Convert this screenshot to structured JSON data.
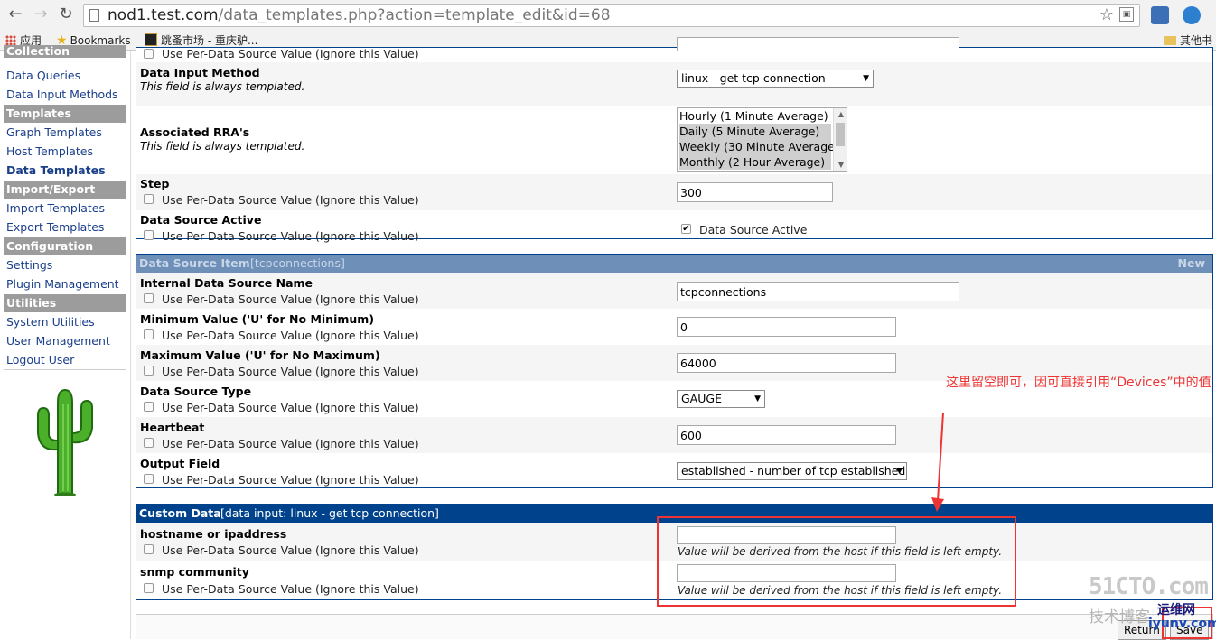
{
  "browser": {
    "url_host": "nod1.test.com",
    "url_path": "/data_templates.php?action=template_edit&id=68",
    "bookmarks": [
      {
        "label": "应用"
      },
      {
        "label": "Bookmarks"
      },
      {
        "label": "跳蚤市场 - 重庆驴..."
      },
      {
        "label": "其他书"
      }
    ]
  },
  "sidebar": {
    "cut_heading": "Collection Methods",
    "items": [
      {
        "label": "Data Queries"
      },
      {
        "label": "Data Input Methods"
      }
    ],
    "sections": [
      {
        "heading": "Templates",
        "items": [
          "Graph Templates",
          "Host Templates",
          "Data Templates"
        ]
      },
      {
        "heading": "Import/Export",
        "items": [
          "Import Templates",
          "Export Templates"
        ]
      },
      {
        "heading": "Configuration",
        "items": [
          "Settings",
          "Plugin Management"
        ]
      },
      {
        "heading": "Utilities",
        "items": [
          "System Utilities",
          "User Management",
          "Logout User"
        ]
      }
    ],
    "active_item": "Data Templates"
  },
  "common": {
    "per_ds_label": "Use Per-Data Source Value (Ignore this Value)",
    "always_templated": "This field is always templated.",
    "derived_hint": "Value will be derived from the host if this field is left empty."
  },
  "data_source": {
    "data_input_method_label": "Data Input Method",
    "data_input_method_value": "linux - get tcp connection",
    "rra_label": "Associated RRA's",
    "rra_options": [
      "Hourly (1 Minute Average)",
      "Daily (5 Minute Average)",
      "Weekly (30 Minute Average)",
      "Monthly (2 Hour Average)"
    ],
    "step_label": "Step",
    "step_value": "300",
    "active_label": "Data Source Active",
    "active_checkbox_label": "Data Source Active"
  },
  "ds_item": {
    "header": "Data Source Item",
    "header_bracket": "[tcpconnections]",
    "header_right": "New",
    "internal_name_label": "Internal Data Source Name",
    "internal_name_value": "tcpconnections",
    "min_label": "Minimum Value ('U' for No Minimum)",
    "min_value": "0",
    "max_label": "Maximum Value ('U' for No Maximum)",
    "max_value": "64000",
    "type_label": "Data Source Type",
    "type_value": "GAUGE",
    "heartbeat_label": "Heartbeat",
    "heartbeat_value": "600",
    "output_label": "Output Field",
    "output_value": "established - number of tcp established"
  },
  "custom_data": {
    "header": "Custom Data",
    "header_bracket": "[data input: linux - get tcp connection]",
    "hostname_label": "hostname or ipaddress",
    "hostname_value": "",
    "snmp_label": "snmp community",
    "snmp_value": ""
  },
  "buttons": {
    "return_label": "Return",
    "save_label": "Save"
  },
  "annotation": {
    "text": "这里留空即可，因可直接引用“Devices”中的值",
    "color": "#e33333"
  },
  "watermark": {
    "line1": "51CTO.com",
    "line2": "技术博客",
    "line3": "运维网",
    "line4": "iyunv.com"
  },
  "colors": {
    "panel_header": "#00438c",
    "sidebar_header": "#9c9c9c",
    "link": "#1a3f8a"
  }
}
